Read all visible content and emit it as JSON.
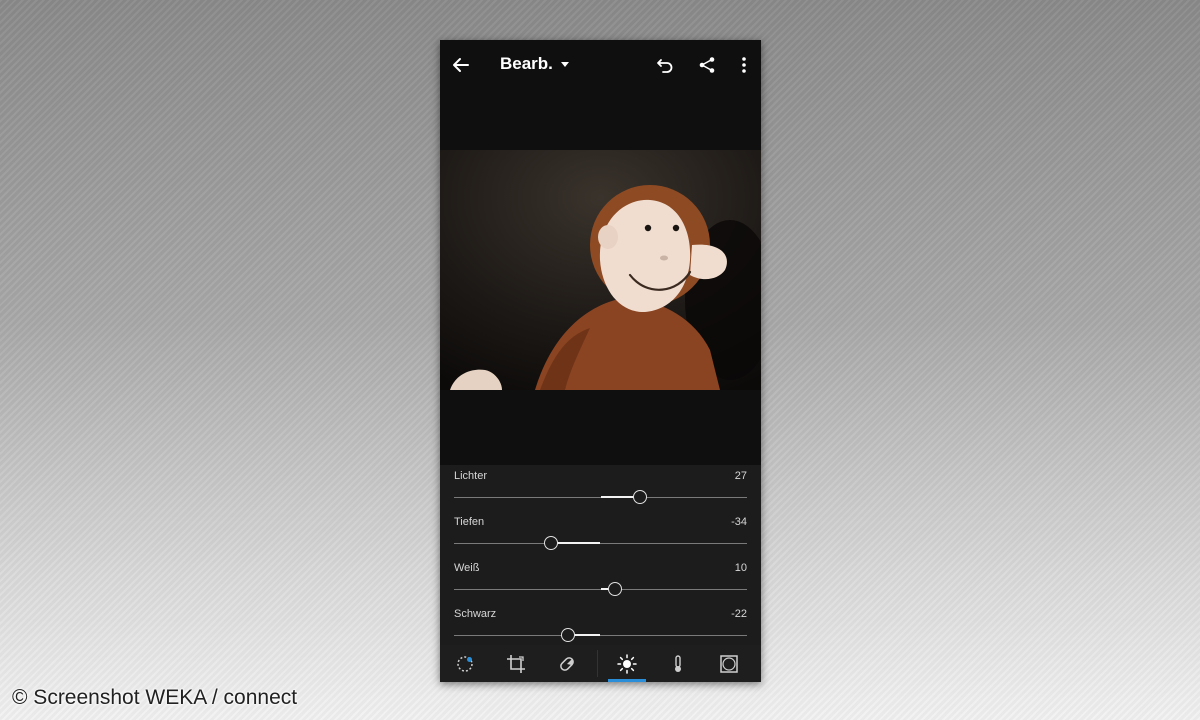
{
  "header": {
    "title": "Bearb.",
    "back_icon": "arrow-left-icon",
    "undo_icon": "undo-icon",
    "share_icon": "share-icon",
    "more_icon": "more-vertical-icon"
  },
  "photo": {
    "subject": ""
  },
  "sliders": [
    {
      "label": "Lichter",
      "value": "27",
      "position_pct": 63.5
    },
    {
      "label": "Tiefen",
      "value": "-34",
      "position_pct": 33
    },
    {
      "label": "Weiß",
      "value": "10",
      "position_pct": 55
    },
    {
      "label": "Schwarz",
      "value": "-22",
      "position_pct": 39
    }
  ],
  "toolbar": {
    "tools": [
      "presets-icon",
      "crop-icon",
      "healing-icon",
      "light-icon",
      "color-temperature-icon",
      "vignette-icon"
    ],
    "active_tool": "light-icon",
    "accent_color": "#2a8fd8"
  },
  "watermark": "© Screenshot WEKA / connect"
}
